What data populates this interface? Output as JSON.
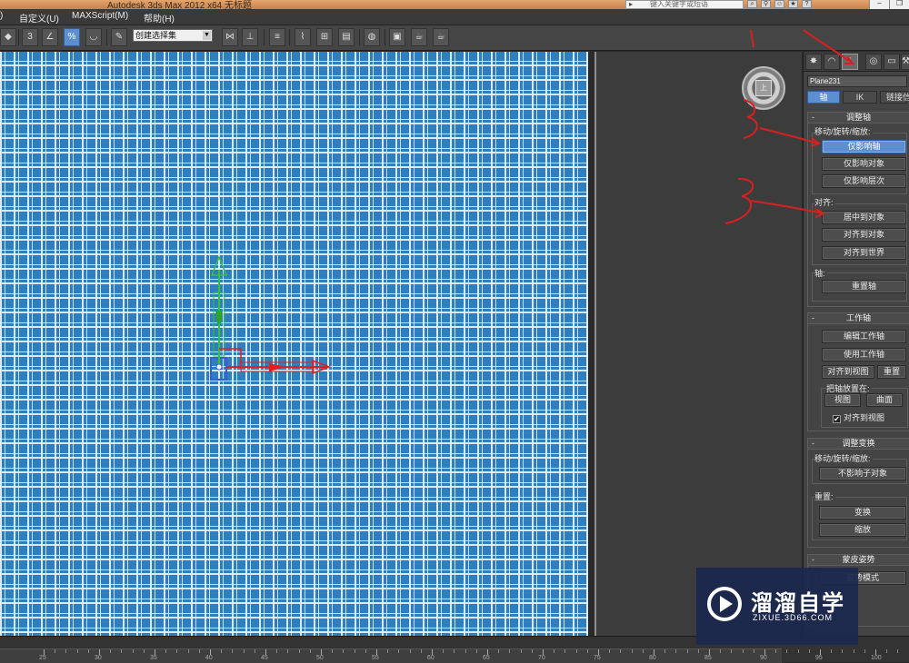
{
  "window": {
    "title": "Autodesk 3ds Max  2012 x64      无标题",
    "search_placeholder": "键入关键字或短语"
  },
  "menu": {
    "items": [
      "自定义(U)",
      "MAXScript(M)",
      "帮助(H)"
    ]
  },
  "toolbar": {
    "snap_label": "3",
    "percent_label": "%",
    "selection_set": "创建选择集"
  },
  "viewport": {
    "grid_color": "#2f7fbe",
    "gizmo_colors": {
      "y_axis": "#3bbf3b",
      "x_axis": "#e02020",
      "selection": "#3b5bdb"
    }
  },
  "navigation": {
    "cube_label": "上"
  },
  "command_panel": {
    "object_name": "Plane231",
    "subtabs": [
      "轴",
      "IK",
      "链接信"
    ],
    "active_subtab": "轴",
    "adjust_pivot": {
      "title": "调整轴",
      "move_group_label": "移动/旋转/缩放:",
      "affect_pivot_only": "仅影响轴",
      "affect_object_only": "仅影响对象",
      "affect_hierarchy_only": "仅影响层次",
      "align_group_label": "对齐:",
      "center_to_object": "居中到对象",
      "align_to_object": "对齐到对象",
      "align_to_world": "对齐到世界",
      "pivot_group_label": "轴:",
      "reset_pivot": "重置轴"
    },
    "working_pivot": {
      "title": "工作轴",
      "edit_working_pivot": "编辑工作轴",
      "use_working_pivot": "使用工作轴",
      "align_to_view": "对齐到视图",
      "reset": "重置",
      "place_pivot_label": "把轴放置在:",
      "view": "视图",
      "surface": "曲面",
      "align_to_view_checkbox": "对齐到视图",
      "align_to_view_checked": "✔"
    },
    "adjust_transform": {
      "title": "调整变换",
      "move_group_label": "移动/旋转/缩放:",
      "dont_affect_children": "不影响子对象",
      "reset_group_label": "重置:",
      "transform": "变换",
      "scale": "缩放"
    },
    "skin_pose": {
      "title": "蒙皮姿势",
      "mode": "姿势模式"
    }
  },
  "timeline": {
    "labels": [
      "25",
      "30",
      "35",
      "40",
      "45",
      "50",
      "55",
      "60",
      "65",
      "70",
      "75",
      "80",
      "85",
      "90",
      "95",
      "100"
    ]
  },
  "watermark": {
    "brand_cn": "溜溜自学",
    "url": "ZIXUE.3D66.COM"
  },
  "annotations": {
    "color": "#d82020",
    "mark_one": "1"
  }
}
